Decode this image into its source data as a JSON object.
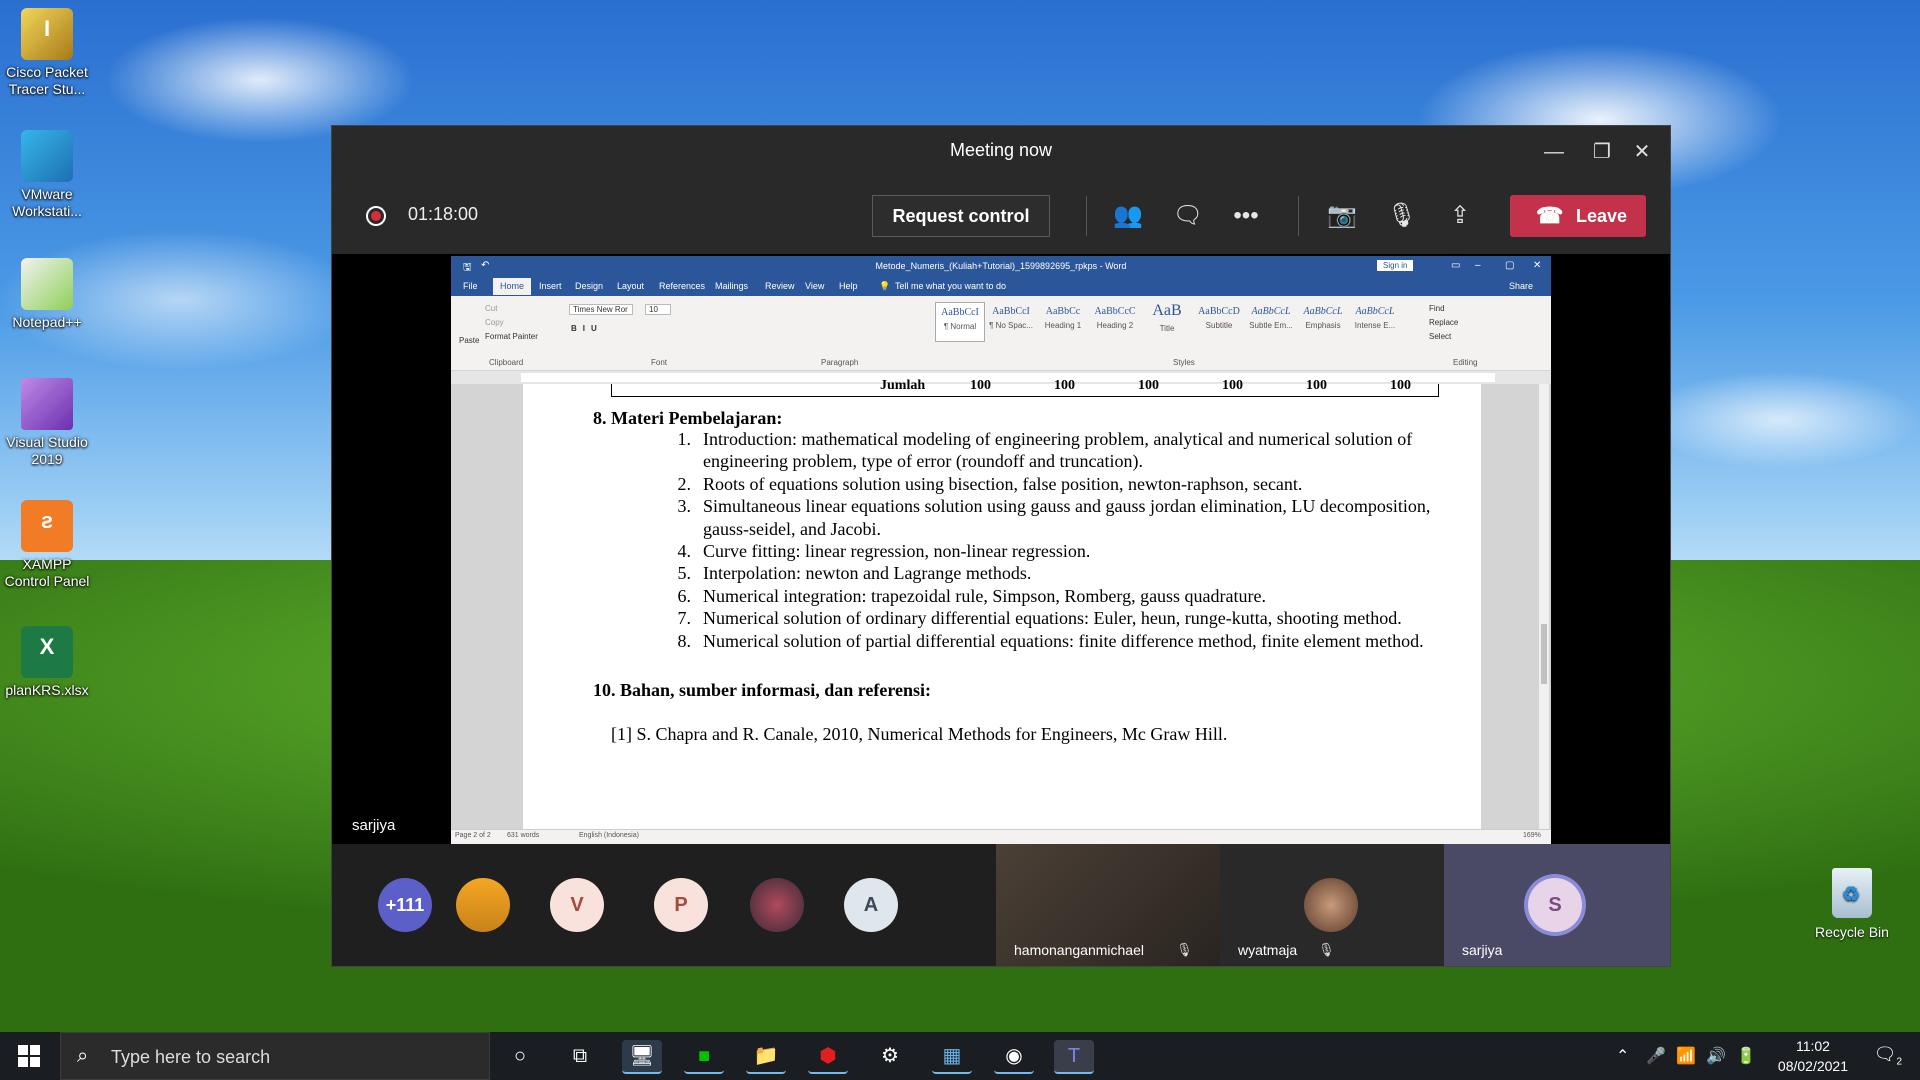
{
  "desktop": {
    "icons": [
      {
        "label_1": "Cisco Packet",
        "label_2": "Tracer Stu..."
      },
      {
        "label_1": "VMware",
        "label_2": "Workstati..."
      },
      {
        "label_1": "Notepad++",
        "label_2": ""
      },
      {
        "label_1": "Visual Studio",
        "label_2": "2019"
      },
      {
        "label_1": "XAMPP",
        "label_2": "Control Panel"
      },
      {
        "label_1": "planKRS.xlsx",
        "label_2": ""
      }
    ],
    "recycle_bin": "Recycle Bin"
  },
  "teams": {
    "window_title": "Meeting now",
    "timer": "01:18:00",
    "request_control": "Request control",
    "leave": "Leave",
    "presenter_name": "sarjiya",
    "participants": {
      "overflow": "+111",
      "initials": [
        "V",
        "P",
        "A"
      ],
      "video_tiles": [
        {
          "name": "hamonanganmichael"
        },
        {
          "name": "wyatmaja"
        },
        {
          "name": "sarjiya",
          "initial": "S"
        }
      ]
    }
  },
  "word": {
    "doc_title": "Metode_Numeris_(Kuliah+Tutorial)_1599892695_rpkps - Word",
    "sign_in": "Sign in",
    "tabs": [
      "File",
      "Home",
      "Insert",
      "Design",
      "Layout",
      "References",
      "Mailings",
      "Review",
      "View",
      "Help"
    ],
    "tell_me": "Tell me what you want to do",
    "share": "Share",
    "ribbon": {
      "paste": "Paste",
      "cut": "Cut",
      "copy": "Copy",
      "format_painter": "Format Painter",
      "font_name": "Times New Ror",
      "font_size": "10",
      "groups": [
        "Clipboard",
        "Font",
        "Paragraph",
        "Styles",
        "Editing"
      ],
      "styles": [
        {
          "sample": "AaBbCcI",
          "name": "¶ Normal"
        },
        {
          "sample": "AaBbCcI",
          "name": "¶ No Spac..."
        },
        {
          "sample": "AaBbCc",
          "name": "Heading 1"
        },
        {
          "sample": "AaBbCcC",
          "name": "Heading 2"
        },
        {
          "sample": "AaB",
          "name": "Title"
        },
        {
          "sample": "AaBbCcD",
          "name": "Subtitle"
        },
        {
          "sample": "AaBbCcL",
          "name": "Subtle Em..."
        },
        {
          "sample": "AaBbCcL",
          "name": "Emphasis"
        },
        {
          "sample": "AaBbCcL",
          "name": "Intense E..."
        }
      ],
      "find": "Find",
      "replace": "Replace",
      "select": "Select"
    },
    "table_row": {
      "label": "Jumlah",
      "values": [
        "100",
        "100",
        "100",
        "100",
        "100",
        "100"
      ]
    },
    "section8_title": "8. Materi Pembelajaran:",
    "items": [
      {
        "num": "1.",
        "text": "Introduction: mathematical modeling of engineering problem, analytical and numerical solution of engineering problem, type of error (roundoff and truncation)."
      },
      {
        "num": "2.",
        "text": "Roots of equations solution using bisection, false position, newton-raphson, secant."
      },
      {
        "num": "3.",
        "text": "Simultaneous linear equations solution using gauss and gauss jordan elimination, LU decomposition, gauss-seidel, and Jacobi."
      },
      {
        "num": "4.",
        "text": "Curve fitting: linear regression, non-linear regression."
      },
      {
        "num": "5.",
        "text": "Interpolation: newton and Lagrange methods."
      },
      {
        "num": "6.",
        "text": "Numerical integration: trapezoidal rule, Simpson, Romberg, gauss quadrature."
      },
      {
        "num": "7.",
        "text": "Numerical solution of ordinary differential equations: Euler, heun, runge-kutta, shooting method."
      },
      {
        "num": "8.",
        "text": "Numerical solution of partial differential equations: finite difference method, finite element method."
      }
    ],
    "section10_title": "10. Bahan, sumber informasi, dan referensi:",
    "reference": "[1] S. Chapra and R. Canale, 2010, Numerical Methods for Engineers, Mc Graw Hill.",
    "status": {
      "page": "Page 2 of 2",
      "words": "631 words",
      "language": "English (Indonesia)",
      "zoom": "169%"
    }
  },
  "taskbar": {
    "search_placeholder": "Type here to search",
    "time": "11:02",
    "date": "08/02/2021",
    "notifications": "2"
  }
}
